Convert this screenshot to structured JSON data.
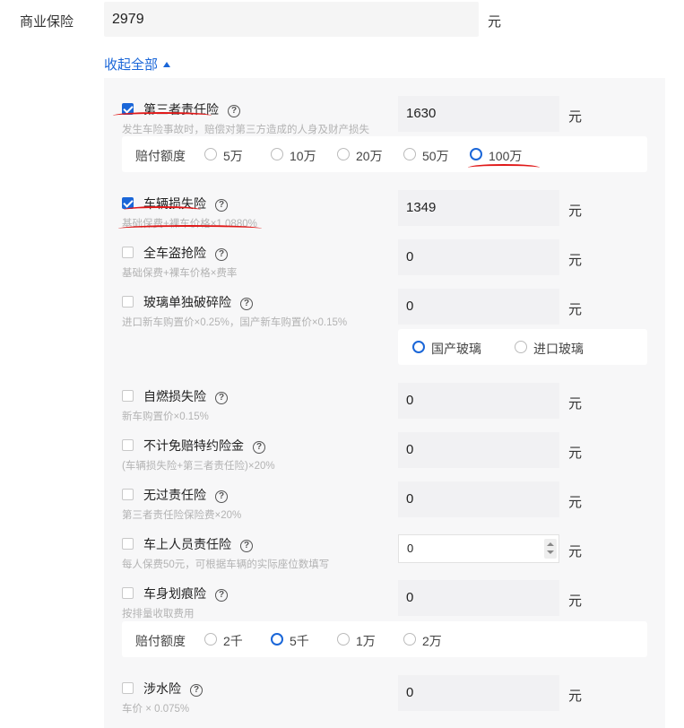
{
  "top": {
    "label": "商业保险",
    "value": "2979",
    "unit": "元",
    "collapse_label": "收起全部"
  },
  "items": [
    {
      "name": "第三者责任险",
      "desc": "发生车险事故时，赔偿对第三方造成的人身及财产损失",
      "value": "1630",
      "unit": "元",
      "checked": true
    },
    {
      "name": "车辆损失险",
      "desc": "基础保费+裸车价格×1.0880%",
      "value": "1349",
      "unit": "元",
      "checked": true
    },
    {
      "name": "全车盗抢险",
      "desc": "基础保费+裸车价格×费率",
      "value": "0",
      "unit": "元",
      "checked": false
    },
    {
      "name": "玻璃单独破碎险",
      "desc": "进口新车购置价×0.25%，国产新车购置价×0.15%",
      "value": "0",
      "unit": "元",
      "checked": false
    },
    {
      "name": "自燃损失险",
      "desc": "新车购置价×0.15%",
      "value": "0",
      "unit": "元",
      "checked": false
    },
    {
      "name": "不计免赔特约险金",
      "desc": "(车辆损失险+第三者责任险)×20%",
      "value": "0",
      "unit": "元",
      "checked": false
    },
    {
      "name": "无过责任险",
      "desc": "第三者责任险保险费×20%",
      "value": "0",
      "unit": "元",
      "checked": false
    },
    {
      "name": "车上人员责任险",
      "desc": "每人保费50元，可根据车辆的实际座位数填写",
      "value": "0",
      "unit": "元",
      "checked": false
    },
    {
      "name": "车身划痕险",
      "desc": "按排量收取费用",
      "value": "0",
      "unit": "元",
      "checked": false
    },
    {
      "name": "涉水险",
      "desc": "车价 × 0.075%",
      "value": "0",
      "unit": "元",
      "checked": false
    }
  ],
  "third_party_options": {
    "label": "赔付额度",
    "options": [
      "5万",
      "10万",
      "20万",
      "50万",
      "100万"
    ],
    "selected": "100万"
  },
  "glass_options": {
    "options": [
      "国产玻璃",
      "进口玻璃"
    ],
    "selected": "国产玻璃"
  },
  "scratch_options": {
    "label": "赔付额度",
    "options": [
      "2千",
      "5千",
      "1万",
      "2万"
    ],
    "selected": "5千"
  },
  "help_icon_glyph": "?",
  "accent_color": "#1a66d8",
  "annotation_color": "#e01818"
}
